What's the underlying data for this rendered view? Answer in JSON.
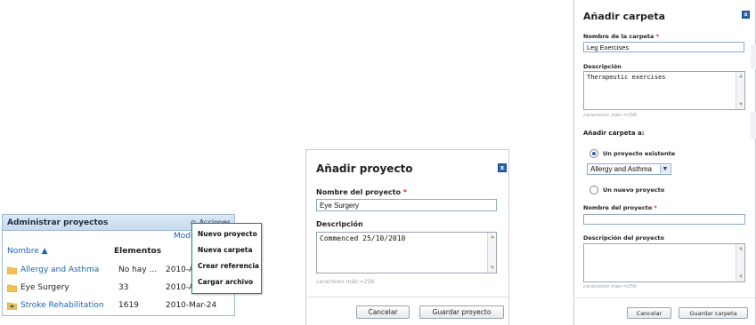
{
  "admin": {
    "title": "Administrar proyectos",
    "actions_label": "Acciones",
    "mod_link": "Modi",
    "columns": {
      "name": "Nombre ▲",
      "elements": "Elementos"
    },
    "rows": [
      {
        "name": "Allergy and Asthma",
        "count": "No hay ...",
        "date": "2010-A"
      },
      {
        "name": "Eye Surgery",
        "count": "33",
        "date": "2010-A"
      },
      {
        "name": "Stroke Rehabilitation",
        "count": "1619",
        "date": "2010-Mar-24"
      }
    ],
    "menu": [
      "Nuevo proyecto",
      "Nueva carpeta",
      "Crear referencia",
      "Cargar archivo"
    ]
  },
  "project_dialog": {
    "title": "Añadir proyecto",
    "close": "x",
    "name_label": "Nombre del proyecto",
    "required_mark": "*",
    "name_value": "Eye Surgery",
    "description_label": "Descripción",
    "description_value": "Commenced 25/10/2010",
    "hint": "caracteres máx:=256",
    "cancel_label": "Cancelar",
    "save_label": "Guardar proyecto"
  },
  "folder_dialog": {
    "title": "Añadir carpeta",
    "close": "x",
    "name_label": "Nombre de la carpeta",
    "required_mark": "*",
    "name_value": "Leg Exercises",
    "description_label": "Descripción",
    "description_value": "Therapeutic exercises",
    "hint": "caracteres máx:=256",
    "add_to_label": "Añadir carpeta a:",
    "radio_existing": "Un proyecto existente",
    "existing_selected": "Allergy and Asthma",
    "radio_new": "Un nuevo proyecto",
    "project_name_label": "Nombre del proyecto",
    "project_name_value": "",
    "project_desc_label": "Descripción del proyecto",
    "project_desc_value": "",
    "hint2": "caracteres máx:=256",
    "cancel_label": "Cancelar",
    "save_label": "Guardar carpeta"
  }
}
